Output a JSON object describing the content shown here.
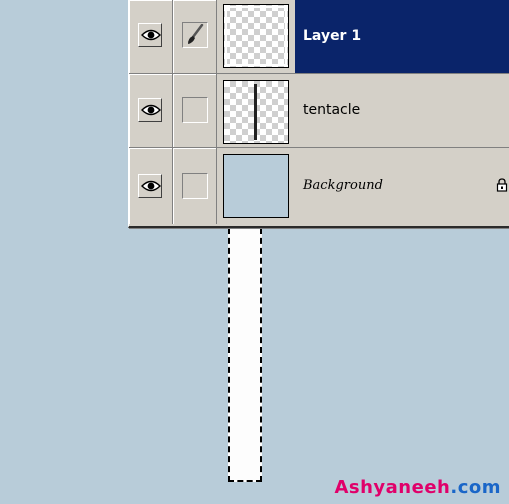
{
  "layers": [
    {
      "name": "Layer 1",
      "selected": true,
      "visible": true,
      "brush_linked": true,
      "thumbnail": "transparent"
    },
    {
      "name": "tentacle",
      "selected": false,
      "visible": true,
      "brush_linked": false,
      "thumbnail": "transparent-with-line"
    },
    {
      "name": "Background",
      "selected": false,
      "visible": true,
      "brush_linked": false,
      "locked": true,
      "thumbnail": "solid"
    }
  ],
  "icons": {
    "visibility": "eye-icon",
    "brush": "brush-icon",
    "lock": "lock-icon"
  },
  "colors": {
    "canvas": "#b8ccd9",
    "panel": "#d4d0c8",
    "selection_highlight": "#0a246a"
  },
  "watermark": {
    "main": "Ashyaneeh",
    "suffix": ".com"
  }
}
